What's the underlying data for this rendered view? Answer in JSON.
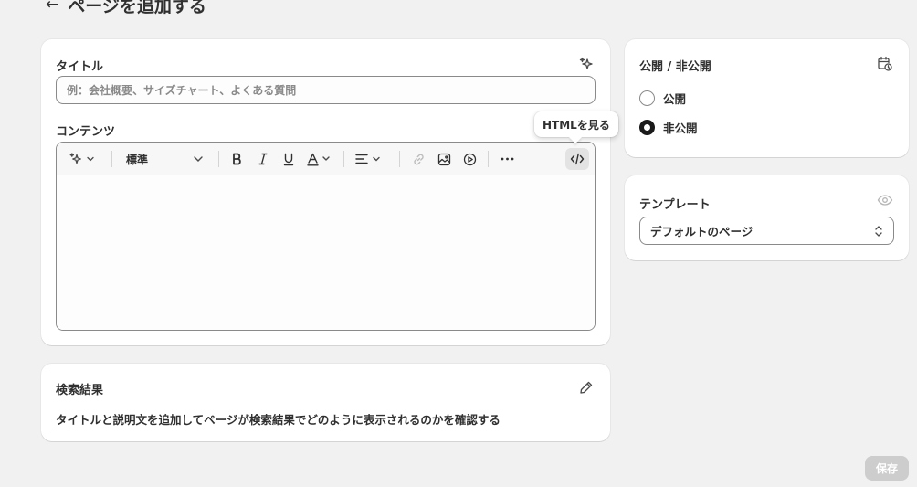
{
  "header": {
    "back_icon": "arrow-left-icon",
    "title": "ページを追加する"
  },
  "main_card": {
    "title_label": "タイトル",
    "title_placeholder": "例：会社概要、サイズチャート、よくある質問",
    "title_value": "",
    "content_label": "コンテンツ",
    "toolbar": {
      "format_value": "標準",
      "tooltip": "HTMLを見る",
      "icons": [
        "sparkle-icon",
        "bold-icon",
        "italic-icon",
        "underline-icon",
        "text-color-icon",
        "align-icon",
        "link-icon",
        "image-icon",
        "video-icon",
        "more-icon",
        "code-icon"
      ]
    }
  },
  "search_card": {
    "label": "検索結果",
    "description": "タイトルと説明文を追加してページが検索結果でどのように表示されるのかを確認する"
  },
  "visibility_card": {
    "label": "公開 / 非公開",
    "options": [
      {
        "label": "公開",
        "checked": false
      },
      {
        "label": "非公開",
        "checked": true
      }
    ]
  },
  "template_card": {
    "label": "テンプレート",
    "value": "デフォルトのページ"
  },
  "footer": {
    "save_label": "保存"
  },
  "colors": {
    "background": "#f1f1f1",
    "card": "#ffffff",
    "text": "#303030",
    "save_disabled": "#cdcdcd"
  }
}
